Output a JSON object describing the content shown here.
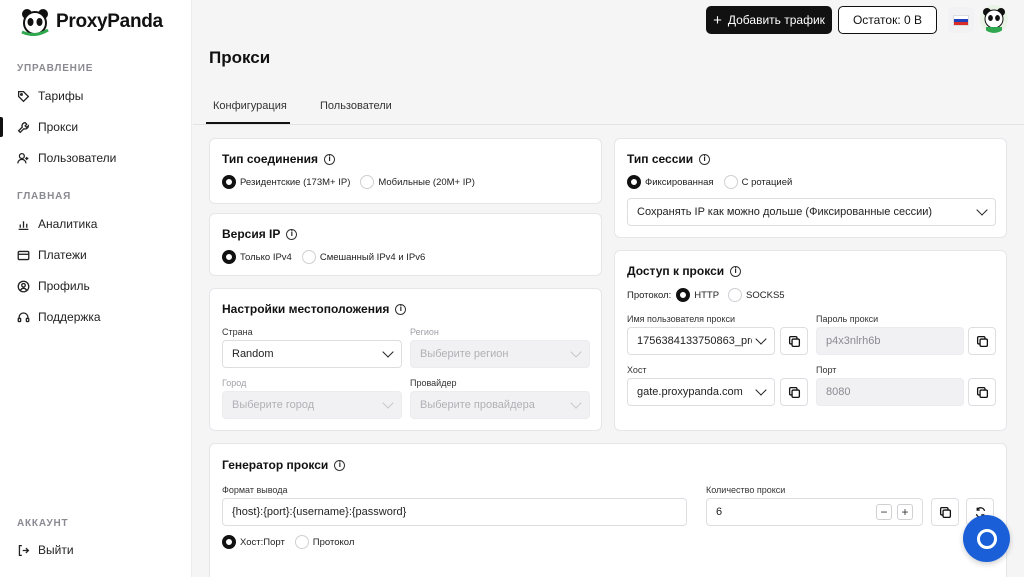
{
  "brand": {
    "name": "ProxyPanda"
  },
  "sidebar": {
    "sections": [
      {
        "title": "УПРАВЛЕНИЕ"
      },
      {
        "title": "ГЛАВНАЯ"
      },
      {
        "title": "АККАУНТ"
      }
    ],
    "items": [
      {
        "label": "Тарифы",
        "icon": "tag-icon"
      },
      {
        "label": "Прокси",
        "icon": "wrench-icon",
        "active": true
      },
      {
        "label": "Пользователи",
        "icon": "users-icon"
      },
      {
        "label": "Аналитика",
        "icon": "chart-icon"
      },
      {
        "label": "Платежи",
        "icon": "card-icon"
      },
      {
        "label": "Профиль",
        "icon": "profile-icon"
      },
      {
        "label": "Поддержка",
        "icon": "headset-icon"
      },
      {
        "label": "Выйти",
        "icon": "logout-icon"
      }
    ]
  },
  "topbar": {
    "add_traffic": "Добавить трафик",
    "balance_label": "Остаток:",
    "balance_value": "0 B"
  },
  "page": {
    "title": "Прокси",
    "tabs": [
      {
        "label": "Конфигурация",
        "active": true
      },
      {
        "label": "Пользователи"
      }
    ]
  },
  "connection_type": {
    "title": "Тип соединения",
    "options": [
      {
        "label": "Резидентские (173M+ IP)",
        "selected": true
      },
      {
        "label": "Мобильные (20M+ IP)"
      }
    ]
  },
  "ip_version": {
    "title": "Версия IP",
    "options": [
      {
        "label": "Только IPv4",
        "selected": true
      },
      {
        "label": "Смешанный IPv4 и IPv6"
      }
    ]
  },
  "location": {
    "title": "Настройки местоположения",
    "country_label": "Страна",
    "country_value": "Random",
    "region_label": "Регион",
    "region_placeholder": "Выберите регион",
    "city_label": "Город",
    "city_placeholder": "Выберите город",
    "provider_label": "Провайдер",
    "provider_placeholder": "Выберите провайдера"
  },
  "session_type": {
    "title": "Тип сессии",
    "options": [
      {
        "label": "Фиксированная",
        "selected": true
      },
      {
        "label": "С ротацией"
      }
    ],
    "select_value": "Сохранять IP как можно дольше (Фиксированные сессии)"
  },
  "proxy_access": {
    "title": "Доступ к прокси",
    "protocol_label": "Протокол:",
    "protocols": [
      {
        "label": "HTTP",
        "selected": true
      },
      {
        "label": "SOCKS5"
      }
    ],
    "username_label": "Имя пользователя прокси",
    "username_value": "1756384133750863_pro",
    "password_label": "Пароль прокси",
    "password_value": "p4x3nlrh6b",
    "host_label": "Хост",
    "host_value": "gate.proxypanda.com",
    "port_label": "Порт",
    "port_value": "8080"
  },
  "generator": {
    "title": "Генератор прокси",
    "format_label": "Формат вывода",
    "format_value": "{host}:{port}:{username}:{password}",
    "count_label": "Количество прокси",
    "count_value": "6",
    "minus": "−",
    "plus": "+",
    "mode_options": [
      {
        "label": "Хост:Порт",
        "selected": true
      },
      {
        "label": "Протокол"
      }
    ]
  },
  "colors": {
    "primary": "#111111",
    "accent_blue": "#1a5fd8",
    "background": "#f5f5f6"
  }
}
